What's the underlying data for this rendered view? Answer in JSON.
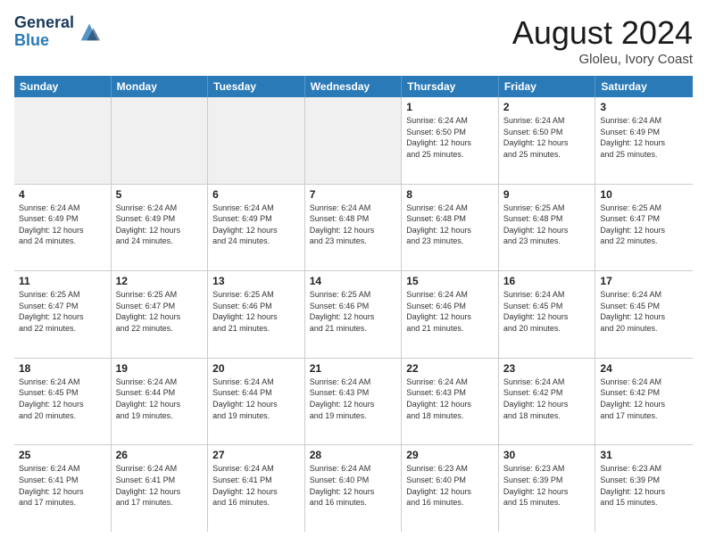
{
  "header": {
    "logo_general": "General",
    "logo_blue": "Blue",
    "month_title": "August 2024",
    "location": "Gloleu, Ivory Coast"
  },
  "days_of_week": [
    "Sunday",
    "Monday",
    "Tuesday",
    "Wednesday",
    "Thursday",
    "Friday",
    "Saturday"
  ],
  "weeks": [
    [
      {
        "day": "",
        "info": "",
        "shaded": true
      },
      {
        "day": "",
        "info": "",
        "shaded": true
      },
      {
        "day": "",
        "info": "",
        "shaded": true
      },
      {
        "day": "",
        "info": "",
        "shaded": true
      },
      {
        "day": "1",
        "info": "Sunrise: 6:24 AM\nSunset: 6:50 PM\nDaylight: 12 hours\nand 25 minutes."
      },
      {
        "day": "2",
        "info": "Sunrise: 6:24 AM\nSunset: 6:50 PM\nDaylight: 12 hours\nand 25 minutes."
      },
      {
        "day": "3",
        "info": "Sunrise: 6:24 AM\nSunset: 6:49 PM\nDaylight: 12 hours\nand 25 minutes."
      }
    ],
    [
      {
        "day": "4",
        "info": "Sunrise: 6:24 AM\nSunset: 6:49 PM\nDaylight: 12 hours\nand 24 minutes."
      },
      {
        "day": "5",
        "info": "Sunrise: 6:24 AM\nSunset: 6:49 PM\nDaylight: 12 hours\nand 24 minutes."
      },
      {
        "day": "6",
        "info": "Sunrise: 6:24 AM\nSunset: 6:49 PM\nDaylight: 12 hours\nand 24 minutes."
      },
      {
        "day": "7",
        "info": "Sunrise: 6:24 AM\nSunset: 6:48 PM\nDaylight: 12 hours\nand 23 minutes."
      },
      {
        "day": "8",
        "info": "Sunrise: 6:24 AM\nSunset: 6:48 PM\nDaylight: 12 hours\nand 23 minutes."
      },
      {
        "day": "9",
        "info": "Sunrise: 6:25 AM\nSunset: 6:48 PM\nDaylight: 12 hours\nand 23 minutes."
      },
      {
        "day": "10",
        "info": "Sunrise: 6:25 AM\nSunset: 6:47 PM\nDaylight: 12 hours\nand 22 minutes."
      }
    ],
    [
      {
        "day": "11",
        "info": "Sunrise: 6:25 AM\nSunset: 6:47 PM\nDaylight: 12 hours\nand 22 minutes."
      },
      {
        "day": "12",
        "info": "Sunrise: 6:25 AM\nSunset: 6:47 PM\nDaylight: 12 hours\nand 22 minutes."
      },
      {
        "day": "13",
        "info": "Sunrise: 6:25 AM\nSunset: 6:46 PM\nDaylight: 12 hours\nand 21 minutes."
      },
      {
        "day": "14",
        "info": "Sunrise: 6:25 AM\nSunset: 6:46 PM\nDaylight: 12 hours\nand 21 minutes."
      },
      {
        "day": "15",
        "info": "Sunrise: 6:24 AM\nSunset: 6:46 PM\nDaylight: 12 hours\nand 21 minutes."
      },
      {
        "day": "16",
        "info": "Sunrise: 6:24 AM\nSunset: 6:45 PM\nDaylight: 12 hours\nand 20 minutes."
      },
      {
        "day": "17",
        "info": "Sunrise: 6:24 AM\nSunset: 6:45 PM\nDaylight: 12 hours\nand 20 minutes."
      }
    ],
    [
      {
        "day": "18",
        "info": "Sunrise: 6:24 AM\nSunset: 6:45 PM\nDaylight: 12 hours\nand 20 minutes."
      },
      {
        "day": "19",
        "info": "Sunrise: 6:24 AM\nSunset: 6:44 PM\nDaylight: 12 hours\nand 19 minutes."
      },
      {
        "day": "20",
        "info": "Sunrise: 6:24 AM\nSunset: 6:44 PM\nDaylight: 12 hours\nand 19 minutes."
      },
      {
        "day": "21",
        "info": "Sunrise: 6:24 AM\nSunset: 6:43 PM\nDaylight: 12 hours\nand 19 minutes."
      },
      {
        "day": "22",
        "info": "Sunrise: 6:24 AM\nSunset: 6:43 PM\nDaylight: 12 hours\nand 18 minutes."
      },
      {
        "day": "23",
        "info": "Sunrise: 6:24 AM\nSunset: 6:42 PM\nDaylight: 12 hours\nand 18 minutes."
      },
      {
        "day": "24",
        "info": "Sunrise: 6:24 AM\nSunset: 6:42 PM\nDaylight: 12 hours\nand 17 minutes."
      }
    ],
    [
      {
        "day": "25",
        "info": "Sunrise: 6:24 AM\nSunset: 6:41 PM\nDaylight: 12 hours\nand 17 minutes."
      },
      {
        "day": "26",
        "info": "Sunrise: 6:24 AM\nSunset: 6:41 PM\nDaylight: 12 hours\nand 17 minutes."
      },
      {
        "day": "27",
        "info": "Sunrise: 6:24 AM\nSunset: 6:41 PM\nDaylight: 12 hours\nand 16 minutes."
      },
      {
        "day": "28",
        "info": "Sunrise: 6:24 AM\nSunset: 6:40 PM\nDaylight: 12 hours\nand 16 minutes."
      },
      {
        "day": "29",
        "info": "Sunrise: 6:23 AM\nSunset: 6:40 PM\nDaylight: 12 hours\nand 16 minutes."
      },
      {
        "day": "30",
        "info": "Sunrise: 6:23 AM\nSunset: 6:39 PM\nDaylight: 12 hours\nand 15 minutes."
      },
      {
        "day": "31",
        "info": "Sunrise: 6:23 AM\nSunset: 6:39 PM\nDaylight: 12 hours\nand 15 minutes."
      }
    ]
  ]
}
